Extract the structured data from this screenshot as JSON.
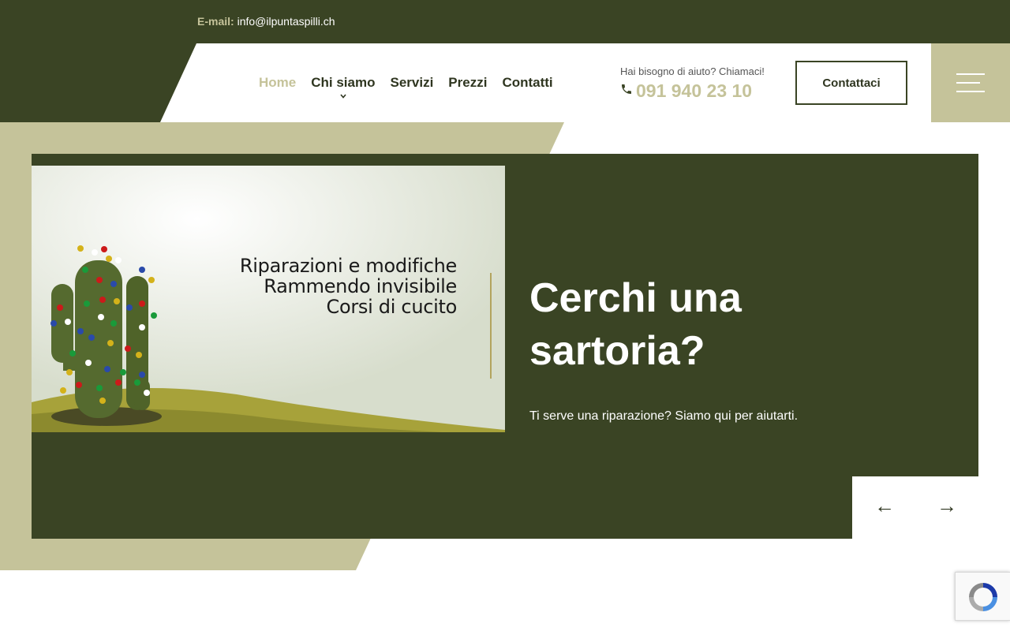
{
  "topbar": {
    "email_label": "E-mail:",
    "email_value": "info@ilpuntaspilli.ch"
  },
  "nav": {
    "items": [
      {
        "label": "Home",
        "active": true
      },
      {
        "label": "Chi siamo",
        "has_dropdown": true
      },
      {
        "label": "Servizi"
      },
      {
        "label": "Prezzi"
      },
      {
        "label": "Contatti"
      }
    ]
  },
  "help": {
    "text": "Hai bisogno di aiuto? Chiamaci!",
    "phone": "091 940 23 10",
    "phone_icon": "phone-icon"
  },
  "cta_button": "Contattaci",
  "hero": {
    "banner_lines": [
      "Riparazioni e modifiche",
      "Rammendo invisibile",
      "Corsi di cucito"
    ],
    "title": "Cerchi una sartoria?",
    "subtitle": "Ti serve una riparazione? Siamo qui per aiutarti.",
    "prev_arrow": "←",
    "next_arrow": "→"
  },
  "colors": {
    "dark_green": "#3a4424",
    "beige": "#c5c39a",
    "white": "#ffffff"
  },
  "icons": [
    "phone-icon",
    "hamburger-menu-icon",
    "chevron-down-icon",
    "arrow-left-icon",
    "arrow-right-icon",
    "recaptcha-icon"
  ]
}
